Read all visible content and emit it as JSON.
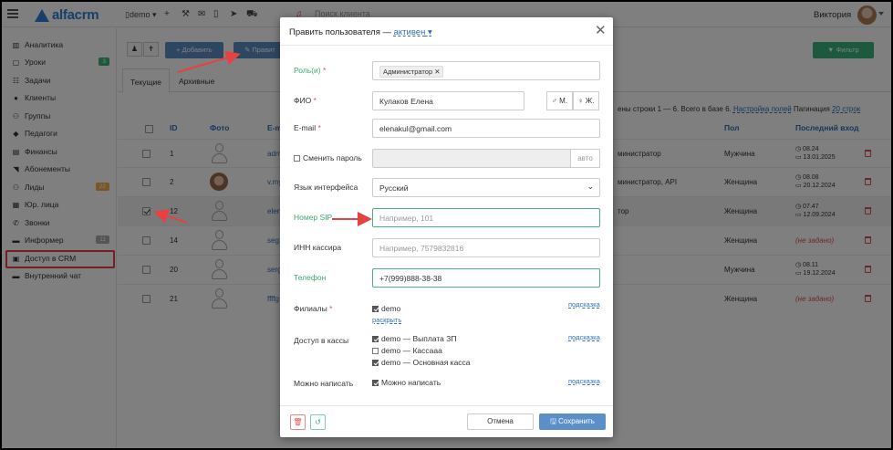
{
  "app": {
    "logo_text": "alfacrm",
    "branch": "demo",
    "search_placeholder": "Поиск клиента",
    "user_name": "Виктория"
  },
  "icons": [
    "menu-icon",
    "building-icon",
    "plus-icon",
    "wrench-icon",
    "mail-icon",
    "phone-icon",
    "send-icon",
    "cart-icon",
    "bell-icon"
  ],
  "sidebar": {
    "items": [
      {
        "label": "Аналитика",
        "icon": "▥"
      },
      {
        "label": "Уроки",
        "icon": "▢",
        "badge": "3",
        "badge_color": "#3bb37a"
      },
      {
        "label": "Задачи",
        "icon": "☷"
      },
      {
        "label": "Клиенты",
        "icon": "●"
      },
      {
        "label": "Группы",
        "icon": "⚇"
      },
      {
        "label": "Педагоги",
        "icon": "◆"
      },
      {
        "label": "Финансы",
        "icon": "▤"
      },
      {
        "label": "Абонементы",
        "icon": "◥"
      },
      {
        "label": "Лиды",
        "icon": "⚇",
        "badge": "22",
        "badge_color": "#f0ad4e"
      },
      {
        "label": "Юр. лица",
        "icon": "▦"
      },
      {
        "label": "Звонки",
        "icon": "✆"
      },
      {
        "label": "Информер",
        "icon": "▬",
        "badge": "11",
        "badge_color": "#aaaaaa"
      },
      {
        "label": "Доступ в CRM",
        "icon": "🔒"
      },
      {
        "label": "Внутренний чат",
        "icon": "▬"
      }
    ]
  },
  "toolbar": {
    "add_label": "+ Добавить",
    "edit_label": "✎ Правит",
    "filter_label": "▼ Фильтр"
  },
  "tabs": {
    "current": "Текущие",
    "archive": "Архивные"
  },
  "pager": {
    "text": "ены строки 1 — 6. Всего в базе 6.",
    "settings": "Настройка полей",
    "pagination": "Пагинация",
    "per_page": "20 строк"
  },
  "table": {
    "headers": {
      "id": "ID",
      "photo": "Фото",
      "email": "E-m",
      "gender": "Пол",
      "last_login": "Последний вход"
    },
    "rows": [
      {
        "id": "1",
        "email": "adm",
        "role": "министратор",
        "gender": "Мужчина",
        "date1": "◷ 08.24",
        "date2": "▭ 13.01.2025",
        "photo": false,
        "checked": false
      },
      {
        "id": "2",
        "email": "v.my",
        "role": "министратор, API",
        "gender": "Женщина",
        "date1": "◷ 08.08",
        "date2": "▭ 20.12.2024",
        "photo": true,
        "checked": false
      },
      {
        "id": "12",
        "email": "elen",
        "role": "тор",
        "gender": "Женщина",
        "date1": "◷ 07.47",
        "date2": "▭ 12.09.2024",
        "photo": false,
        "checked": true
      },
      {
        "id": "14",
        "email": "seg1",
        "role": "",
        "gender": "Женщина",
        "date1": "",
        "date2": "",
        "not_set": "(не задано)",
        "photo": false,
        "checked": false
      },
      {
        "id": "20",
        "email": "serg",
        "role": "",
        "gender": "Мужчина",
        "date1": "◷ 08.11",
        "date2": "▭ 19.12.2024",
        "photo": false,
        "checked": false
      },
      {
        "id": "21",
        "email": "ffffg",
        "role": "",
        "gender": "Женщина",
        "date1": "",
        "date2": "",
        "not_set": "(не задано)",
        "photo": false,
        "checked": false
      }
    ]
  },
  "modal": {
    "title": "Править пользователя —",
    "status": "активен",
    "role_label": "Роль(и)",
    "role_tag": "Администратор ✕",
    "fio_label": "ФИО",
    "fio_value": "Кулаков Елена",
    "gender_m": "♂ М.",
    "gender_f": "♀ Ж.",
    "email_label": "E-mail",
    "email_value": "elenakul@gmail.com",
    "change_password_label": "Сменить пароль",
    "auto_label": "авто",
    "lang_label": "Язык интерфейса",
    "lang_value": "Русский",
    "sip_label": "Номер SIP",
    "sip_placeholder": "Например, 101",
    "inn_label": "ИНН кассира",
    "inn_placeholder": "Например, 7579832816",
    "phone_label": "Телефон",
    "phone_value": "+7(999)888-38-38",
    "branches_label": "Филиалы",
    "branch_option": "demo",
    "expand_link": "раскрыть",
    "cash_label": "Доступ в кассы",
    "cash_options": [
      "demo — Выплата ЗП",
      "demo — Кассааа",
      "demo — Основная касса"
    ],
    "can_write_label": "Можно написать",
    "can_write_option": "Можно написать",
    "hint": "подсказка",
    "cancel_label": "Отмена",
    "save_label": "🖫 Сохранить",
    "required_mark": "*"
  }
}
